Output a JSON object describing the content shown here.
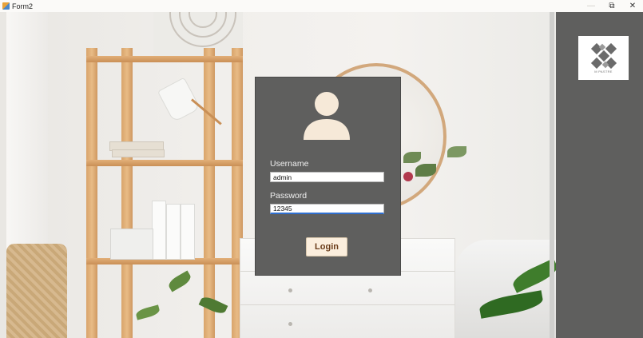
{
  "window": {
    "title": "Form2",
    "minimize_symbol": "—",
    "restore_symbol": "⧉",
    "close_symbol": "✕"
  },
  "logo": {
    "text": "M PASTRE",
    "icon": "interlocking-x-logo"
  },
  "login": {
    "avatar_icon": "user-avatar-icon",
    "username_label": "Username",
    "username_value": "admin",
    "password_label": "Password",
    "password_value": "12345",
    "login_button": "Login"
  },
  "colors": {
    "panel_background": "#5f5f5e",
    "avatar": "#f6e9d8",
    "login_button_bg": "#fbeedd",
    "login_button_text": "#6a3c1a",
    "focus_accent": "#2f6fd0"
  }
}
